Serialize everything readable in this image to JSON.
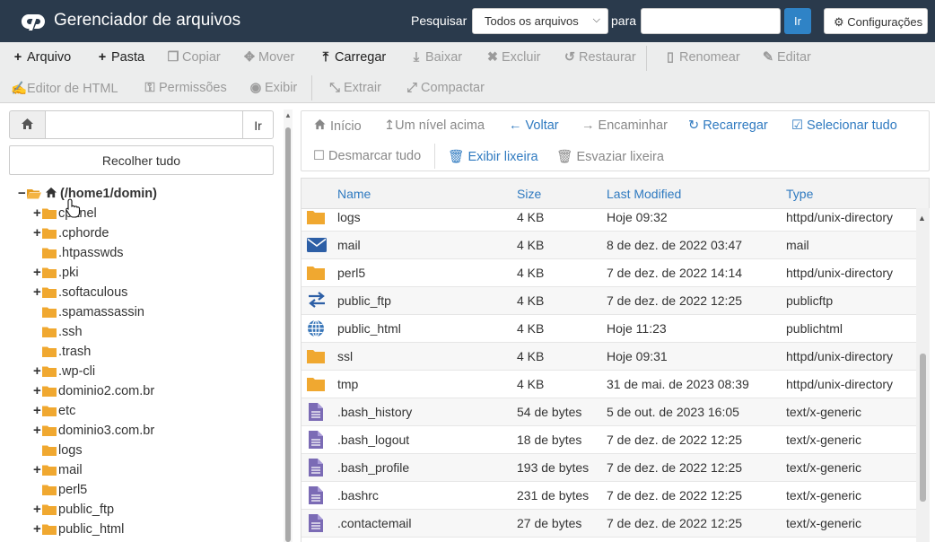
{
  "header": {
    "title": "Gerenciador de arquivos",
    "search_label": "Pesquisar",
    "search_scope": "Todos os arquivos",
    "para_label": "para",
    "search_value": "",
    "go_label": "Ir",
    "settings_label": "Configurações",
    "bg_color": "#2a3a4c"
  },
  "toolbar": {
    "row1": [
      {
        "label": "Arquivo",
        "icon": "plus-icon",
        "enabled": true
      },
      {
        "label": "Pasta",
        "icon": "plus-icon",
        "enabled": true
      },
      {
        "label": "Copiar",
        "icon": "copy-icon",
        "enabled": false
      },
      {
        "label": "Mover",
        "icon": "move-icon",
        "enabled": false
      },
      {
        "label": "Carregar",
        "icon": "upload-icon",
        "enabled": true
      },
      {
        "label": "Baixar",
        "icon": "download-icon",
        "enabled": false
      },
      {
        "label": "Excluir",
        "icon": "delete-icon",
        "enabled": false
      },
      {
        "label": "Restaurar",
        "icon": "restore-icon",
        "enabled": false
      },
      {
        "label": "Renomear",
        "icon": "file-icon",
        "enabled": false
      },
      {
        "label": "Editar",
        "icon": "pencil-icon",
        "enabled": false
      }
    ],
    "row2": [
      {
        "label": "Editor de HTML",
        "icon": "edit-icon",
        "enabled": false
      },
      {
        "label": "Permissões",
        "icon": "key-icon",
        "enabled": false
      },
      {
        "label": "Exibir",
        "icon": "eye-icon",
        "enabled": false
      },
      {
        "label": "Extrair",
        "icon": "expand-icon",
        "enabled": false
      },
      {
        "label": "Compactar",
        "icon": "compress-icon",
        "enabled": false
      }
    ]
  },
  "sidebar": {
    "path_value": "",
    "go_label": "Ir",
    "collapse_label": "Recolher tudo",
    "tree": [
      {
        "label": "(/home1/domin)",
        "toggle": "−",
        "level": 0,
        "root": true
      },
      {
        "label": "cpanel",
        "toggle": "+",
        "level": 1
      },
      {
        "label": ".cphorde",
        "toggle": "+",
        "level": 1
      },
      {
        "label": ".htpasswds",
        "toggle": "",
        "level": 1
      },
      {
        "label": ".pki",
        "toggle": "+",
        "level": 1
      },
      {
        "label": ".softaculous",
        "toggle": "+",
        "level": 1
      },
      {
        "label": ".spamassassin",
        "toggle": "",
        "level": 1
      },
      {
        "label": ".ssh",
        "toggle": "",
        "level": 1
      },
      {
        "label": ".trash",
        "toggle": "",
        "level": 1
      },
      {
        "label": ".wp-cli",
        "toggle": "+",
        "level": 1
      },
      {
        "label": "dominio2.com.br",
        "toggle": "+",
        "level": 1
      },
      {
        "label": "etc",
        "toggle": "+",
        "level": 1
      },
      {
        "label": "dominio3.com.br",
        "toggle": "+",
        "level": 1
      },
      {
        "label": "logs",
        "toggle": "",
        "level": 1
      },
      {
        "label": "mail",
        "toggle": "+",
        "level": 1
      },
      {
        "label": "perl5",
        "toggle": "",
        "level": 1
      },
      {
        "label": "public_ftp",
        "toggle": "+",
        "level": 1
      },
      {
        "label": "public_html",
        "toggle": "+",
        "level": 1
      }
    ]
  },
  "main_toolbar": {
    "row1": [
      {
        "label": "Início",
        "icon": "home-icon",
        "enabled": false
      },
      {
        "label": "Um nível acima",
        "icon": "level-up-icon",
        "enabled": false
      },
      {
        "label": "Voltar",
        "icon": "arrow-left-icon",
        "enabled": true
      },
      {
        "label": "Encaminhar",
        "icon": "arrow-right-icon",
        "enabled": false
      },
      {
        "label": "Recarregar",
        "icon": "reload-icon",
        "enabled": true
      },
      {
        "label": "Selecionar tudo",
        "icon": "checkbox-checked-icon",
        "enabled": true
      }
    ],
    "row2": [
      {
        "label": "Desmarcar tudo",
        "icon": "checkbox-empty-icon",
        "enabled": false
      },
      {
        "label": "Exibir lixeira",
        "icon": "trash-icon",
        "enabled": true
      },
      {
        "label": "Esvaziar lixeira",
        "icon": "trash-icon",
        "enabled": false
      }
    ]
  },
  "table": {
    "columns": [
      "Name",
      "Size",
      "Last Modified",
      "Type"
    ],
    "rows": [
      {
        "icon": "folder-icon",
        "name": "logs",
        "size": "4 KB",
        "modified": "Hoje 09:32",
        "type": "httpd/unix-directory"
      },
      {
        "icon": "mail-icon",
        "name": "mail",
        "size": "4 KB",
        "modified": "8 de dez. de 2022 03:47",
        "type": "mail"
      },
      {
        "icon": "folder-icon",
        "name": "perl5",
        "size": "4 KB",
        "modified": "7 de dez. de 2022 14:14",
        "type": "httpd/unix-directory"
      },
      {
        "icon": "exchange-icon",
        "name": "public_ftp",
        "size": "4 KB",
        "modified": "7 de dez. de 2022 12:25",
        "type": "publicftp"
      },
      {
        "icon": "globe-icon",
        "name": "public_html",
        "size": "4 KB",
        "modified": "Hoje 11:23",
        "type": "publichtml"
      },
      {
        "icon": "folder-icon",
        "name": "ssl",
        "size": "4 KB",
        "modified": "Hoje 09:31",
        "type": "httpd/unix-directory"
      },
      {
        "icon": "folder-icon",
        "name": "tmp",
        "size": "4 KB",
        "modified": "31 de mai. de 2023 08:39",
        "type": "httpd/unix-directory"
      },
      {
        "icon": "text-file-icon",
        "name": ".bash_history",
        "size": "54 de bytes",
        "modified": "5 de out. de 2023 16:05",
        "type": "text/x-generic"
      },
      {
        "icon": "text-file-icon",
        "name": ".bash_logout",
        "size": "18 de bytes",
        "modified": "7 de dez. de 2022 12:25",
        "type": "text/x-generic"
      },
      {
        "icon": "text-file-icon",
        "name": ".bash_profile",
        "size": "193 de bytes",
        "modified": "7 de dez. de 2022 12:25",
        "type": "text/x-generic"
      },
      {
        "icon": "text-file-icon",
        "name": ".bashrc",
        "size": "231 de bytes",
        "modified": "7 de dez. de 2022 12:25",
        "type": "text/x-generic"
      },
      {
        "icon": "text-file-icon",
        "name": ".contactemail",
        "size": "27 de bytes",
        "modified": "7 de dez. de 2022 12:25",
        "type": "text/x-generic"
      }
    ]
  },
  "colors": {
    "accent": "#2f7ac0",
    "folder": "#f0a830",
    "icon_blue": "#2d5fa6",
    "text_file": "#7b6bb5"
  }
}
